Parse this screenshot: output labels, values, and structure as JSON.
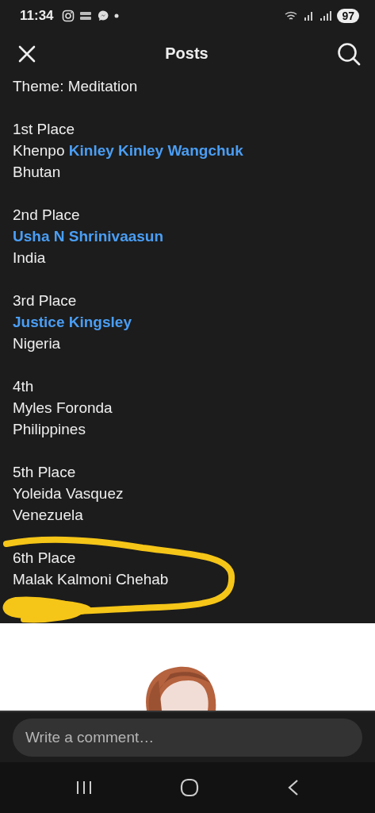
{
  "status_bar": {
    "time": "11:34",
    "battery": "97"
  },
  "header": {
    "title": "Posts"
  },
  "post": {
    "theme": "Theme: Meditation",
    "entries": [
      {
        "place": "1st Place",
        "name_parts": [
          {
            "text": "Khenpo",
            "link": false
          },
          {
            "text": "Kinley Kinley Wangchuk",
            "link": true
          }
        ],
        "country": "Bhutan"
      },
      {
        "place": "2nd Place",
        "name_parts": [
          {
            "text": "Usha N Shrinivaasun",
            "link": true
          }
        ],
        "country": "India"
      },
      {
        "place": "3rd Place",
        "name_parts": [
          {
            "text": "Justice Kingsley",
            "link": true
          }
        ],
        "country": "Nigeria"
      },
      {
        "place": "4th",
        "name_parts": [
          {
            "text": "Myles Foronda",
            "link": false
          }
        ],
        "country": "Philippines"
      },
      {
        "place": "5th Place",
        "name_parts": [
          {
            "text": "Yoleida Vasquez",
            "link": false
          }
        ],
        "country": "Venezuela"
      },
      {
        "place": "6th Place",
        "name_parts": [
          {
            "text": "Malak Kalmoni Chehab",
            "link": false
          }
        ]
      }
    ]
  },
  "comment": {
    "placeholder": "Write a comment…"
  }
}
